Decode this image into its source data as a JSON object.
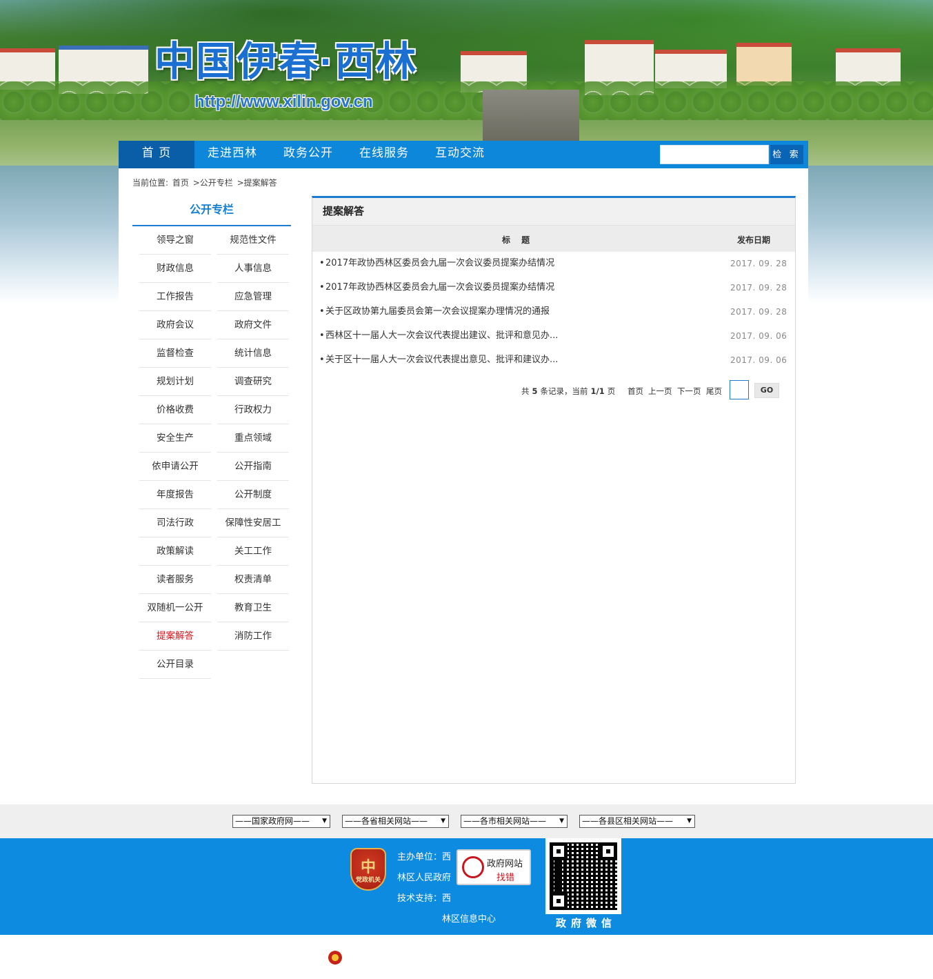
{
  "header": {
    "site_title": "中国伊春·西林",
    "site_url": "http://www.xilin.gov.cn"
  },
  "nav": {
    "items": [
      {
        "label": "首  页",
        "active": true
      },
      {
        "label": "走进西林",
        "active": false
      },
      {
        "label": "政务公开",
        "active": false
      },
      {
        "label": "在线服务",
        "active": false
      },
      {
        "label": "互动交流",
        "active": false
      }
    ],
    "search": {
      "value": "",
      "button_label": "检 索"
    }
  },
  "breadcrumb": {
    "prefix": "当前位置:",
    "items": [
      "首页",
      ">公开专栏",
      ">提案解答"
    ]
  },
  "sidebar": {
    "title": "公开专栏",
    "items": [
      {
        "label": "领导之窗"
      },
      {
        "label": "规范性文件"
      },
      {
        "label": "财政信息"
      },
      {
        "label": "人事信息"
      },
      {
        "label": "工作报告"
      },
      {
        "label": "应急管理"
      },
      {
        "label": "政府会议"
      },
      {
        "label": "政府文件"
      },
      {
        "label": "监督检查"
      },
      {
        "label": "统计信息"
      },
      {
        "label": "规划计划"
      },
      {
        "label": "调查研究"
      },
      {
        "label": "价格收费"
      },
      {
        "label": "行政权力"
      },
      {
        "label": "安全生产"
      },
      {
        "label": "重点领域"
      },
      {
        "label": "依申请公开"
      },
      {
        "label": "公开指南"
      },
      {
        "label": "年度报告"
      },
      {
        "label": "公开制度"
      },
      {
        "label": "司法行政"
      },
      {
        "label": "保障性安居工"
      },
      {
        "label": "政策解读"
      },
      {
        "label": "关工工作"
      },
      {
        "label": "读者服务"
      },
      {
        "label": "权责清单"
      },
      {
        "label": "双随机一公开"
      },
      {
        "label": "教育卫生"
      },
      {
        "label": "提案解答",
        "current": true
      },
      {
        "label": "消防工作"
      },
      {
        "label": "公开目录"
      }
    ]
  },
  "content": {
    "heading": "提案解答",
    "col_title": "标  题",
    "col_date": "发布日期",
    "rows": [
      {
        "bullet": "•",
        "title": "2017年政协西林区委员会九届一次会议委员提案办结情况",
        "date": "2017. 09. 28"
      },
      {
        "bullet": "•",
        "title": "2017年政协西林区委员会九届一次会议委员提案办结情况",
        "date": "2017. 09. 28"
      },
      {
        "bullet": "•",
        "title": "关于区政协第九届委员会第一次会议提案办理情况的通报",
        "date": "2017. 09. 28"
      },
      {
        "bullet": "•",
        "title": "西林区十一届人大一次会议代表提出建议、批评和意见办...",
        "date": "2017. 09. 06"
      },
      {
        "bullet": "•",
        "title": "关于区十一届人大一次会议代表提出意见、批评和建议办...",
        "date": "2017. 09. 06"
      }
    ],
    "pager": {
      "total_prefix": "共",
      "total": "5",
      "total_suffix": "条记录，当前",
      "page": "1/1",
      "page_suffix": "页",
      "first": "首页",
      "prev": "上一页",
      "next": "下一页",
      "last": "尾页",
      "go_label": "GO",
      "page_input_value": ""
    }
  },
  "links": [
    {
      "label": "——国家政府网——",
      "arrow": "▼"
    },
    {
      "label": "——各省相关网站——",
      "arrow": "▼"
    },
    {
      "label": "——各市相关网站——",
      "arrow": "▼"
    },
    {
      "label": "——各县区相关网站——",
      "arrow": "▼"
    }
  ],
  "footer": {
    "emblem_glyph": "中",
    "emblem_text": "党政机关",
    "host_line1": "主办单位：西",
    "host_line2": "林区人民政府",
    "tech_line1": "技术支持：西",
    "tech_line2": "林区信息中心",
    "jiucuo_line1": "政府网站",
    "jiucuo_line2": "找错",
    "qr_label": "政府微信"
  }
}
